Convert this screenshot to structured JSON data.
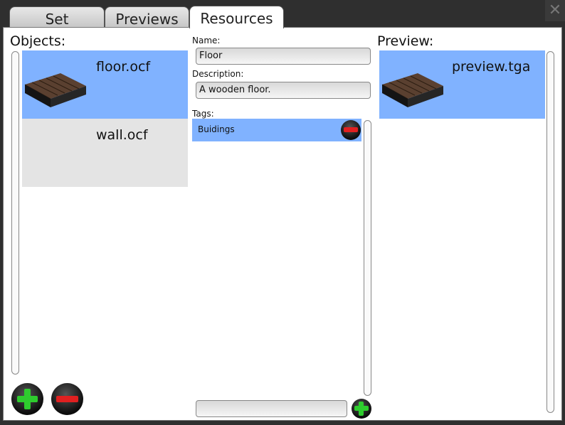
{
  "tabs": [
    {
      "label": "Set"
    },
    {
      "label": "Previews"
    },
    {
      "label": "Resources"
    }
  ],
  "active_tab": "Resources",
  "objects": {
    "header": "Objects:",
    "items": [
      {
        "name": "floor.ocf",
        "selected": true,
        "thumbnail": "floor-tile-icon"
      },
      {
        "name": "wall.ocf",
        "selected": false
      }
    ]
  },
  "details": {
    "name_label": "Name:",
    "name_value": "Floor",
    "description_label": "Description:",
    "description_value": "A wooden floor.",
    "tags_label": "Tags:",
    "tags": [
      {
        "label": "Buidings"
      }
    ],
    "new_tag_value": ""
  },
  "preview": {
    "header": "Preview:",
    "items": [
      {
        "name": "preview.tga",
        "selected": true,
        "thumbnail": "floor-tile-icon"
      }
    ]
  },
  "colors": {
    "selection": "#80b2ff",
    "unselected_item": "#e4e4e4",
    "add_green": "#2ecc2e",
    "remove_red": "#e02020"
  }
}
